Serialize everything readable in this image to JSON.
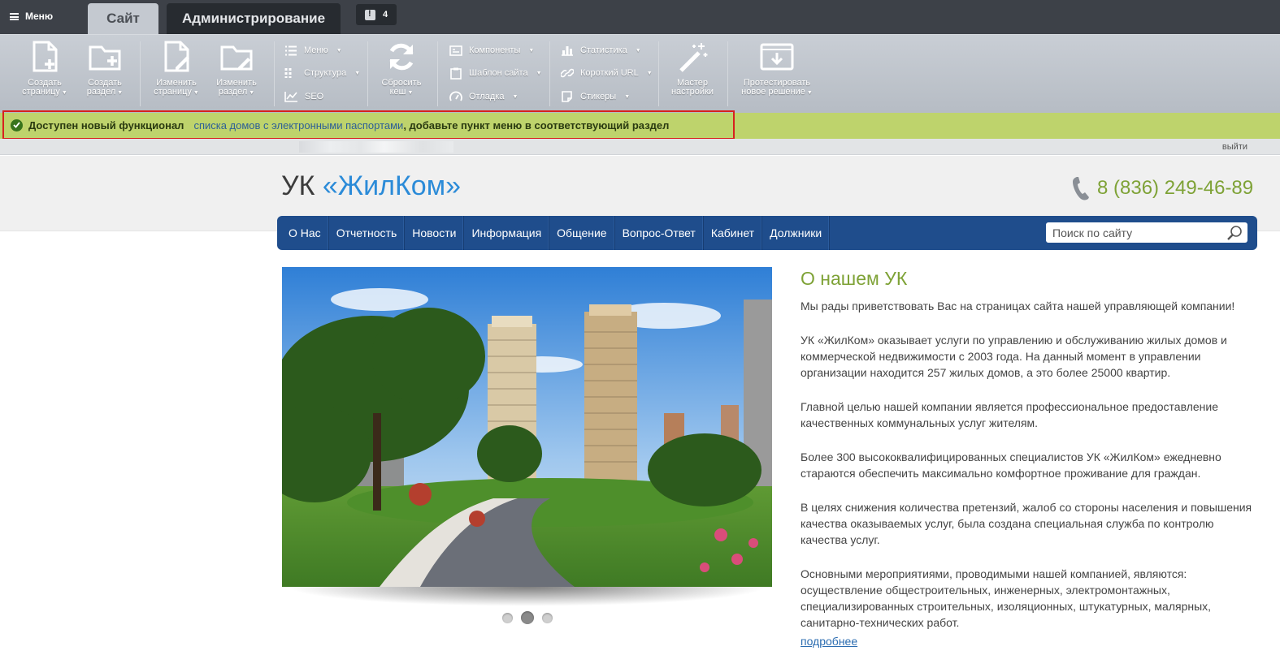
{
  "admin": {
    "menu_label": "Меню",
    "tabs": [
      {
        "label": "Сайт",
        "active": true
      },
      {
        "label": "Администрирование",
        "active": false
      }
    ],
    "notifications_count": "4"
  },
  "toolbar": {
    "create_page": [
      "Создать",
      "страницу"
    ],
    "create_section": [
      "Создать",
      "раздел"
    ],
    "edit_page": [
      "Изменить",
      "страницу"
    ],
    "edit_section": [
      "Изменить",
      "раздел"
    ],
    "menu": "Меню",
    "structure": "Структура",
    "seo": "SEO",
    "clear_cache": [
      "Сбросить",
      "кеш"
    ],
    "components": "Компоненты",
    "site_template": "Шаблон сайта",
    "debug": "Отладка",
    "statistics": "Статистика",
    "short_url": "Короткий URL",
    "stickers": "Стикеры",
    "setup_wizard": [
      "Мастер",
      "настройки"
    ],
    "test_solution": [
      "Протестировать",
      "новое решение"
    ]
  },
  "notice": {
    "title": "Доступен новый функционал",
    "link": "списка домов с электронными паспортами",
    "rest": ", добавьте пункт меню в соответствующий раздел"
  },
  "logout_label": "выйти",
  "site": {
    "logo_prefix": "УК ",
    "logo_name": "«ЖилКом»",
    "phone": "8 (836) 249-46-89"
  },
  "nav": {
    "items": [
      "О Нас",
      "Отчетность",
      "Новости",
      "Информация",
      "Общение",
      "Вопрос-Ответ",
      "Кабинет",
      "Должники"
    ],
    "search_placeholder": "Поиск по сайту"
  },
  "slider": {
    "slides": 3,
    "active_slide": 2
  },
  "about": {
    "title": "О нашем УК",
    "paragraphs": [
      "Мы рады приветствовать Вас на страницах сайта нашей управляющей компании!",
      "УК «ЖилКом» оказывает услуги по управлению и обслуживанию жилых домов и коммерческой недвижимости с 2003 года. На данный момент в управлении организации находится 257 жилых домов, а это более 25000 квартир.",
      "Главной целью нашей компании является профессиональное предоставление качественных коммунальных услуг жителям.",
      "Более 300 высококвалифицированных специалистов УК «ЖилКом» ежедневно стараются обеспечить максимально комфортное проживание для граждан.",
      "В целях снижения количества претензий, жалоб со стороны населения и повышения качества оказываемых услуг, была создана специальная служба по контролю качества услуг.",
      "Основными мероприятиями, проводимыми нашей компанией, являются: осуществление общестроительных, инженерных, электромонтажных, специализированных строительных, изоляционных, штукатурных, малярных, санитарно-технических работ."
    ],
    "more_link": "подробнее"
  },
  "colors": {
    "nav_bg": "#1f4d8c",
    "accent_green": "#7ea236",
    "logo_blue": "#2b8bd8",
    "notice_bg": "#bed36c",
    "notice_border": "#d7201f"
  },
  "icons": [
    "hamburger-icon",
    "notification-icon",
    "page-add-icon",
    "folder-add-icon",
    "page-edit-icon",
    "folder-edit-icon",
    "list-icon",
    "grid-icon",
    "chart-line-icon",
    "refresh-icon",
    "component-icon",
    "clipboard-icon",
    "gauge-icon",
    "bar-chart-icon",
    "link-icon",
    "sticker-icon",
    "magic-wand-icon",
    "monitor-download-icon",
    "check-circle-icon",
    "phone-icon",
    "search-icon"
  ]
}
